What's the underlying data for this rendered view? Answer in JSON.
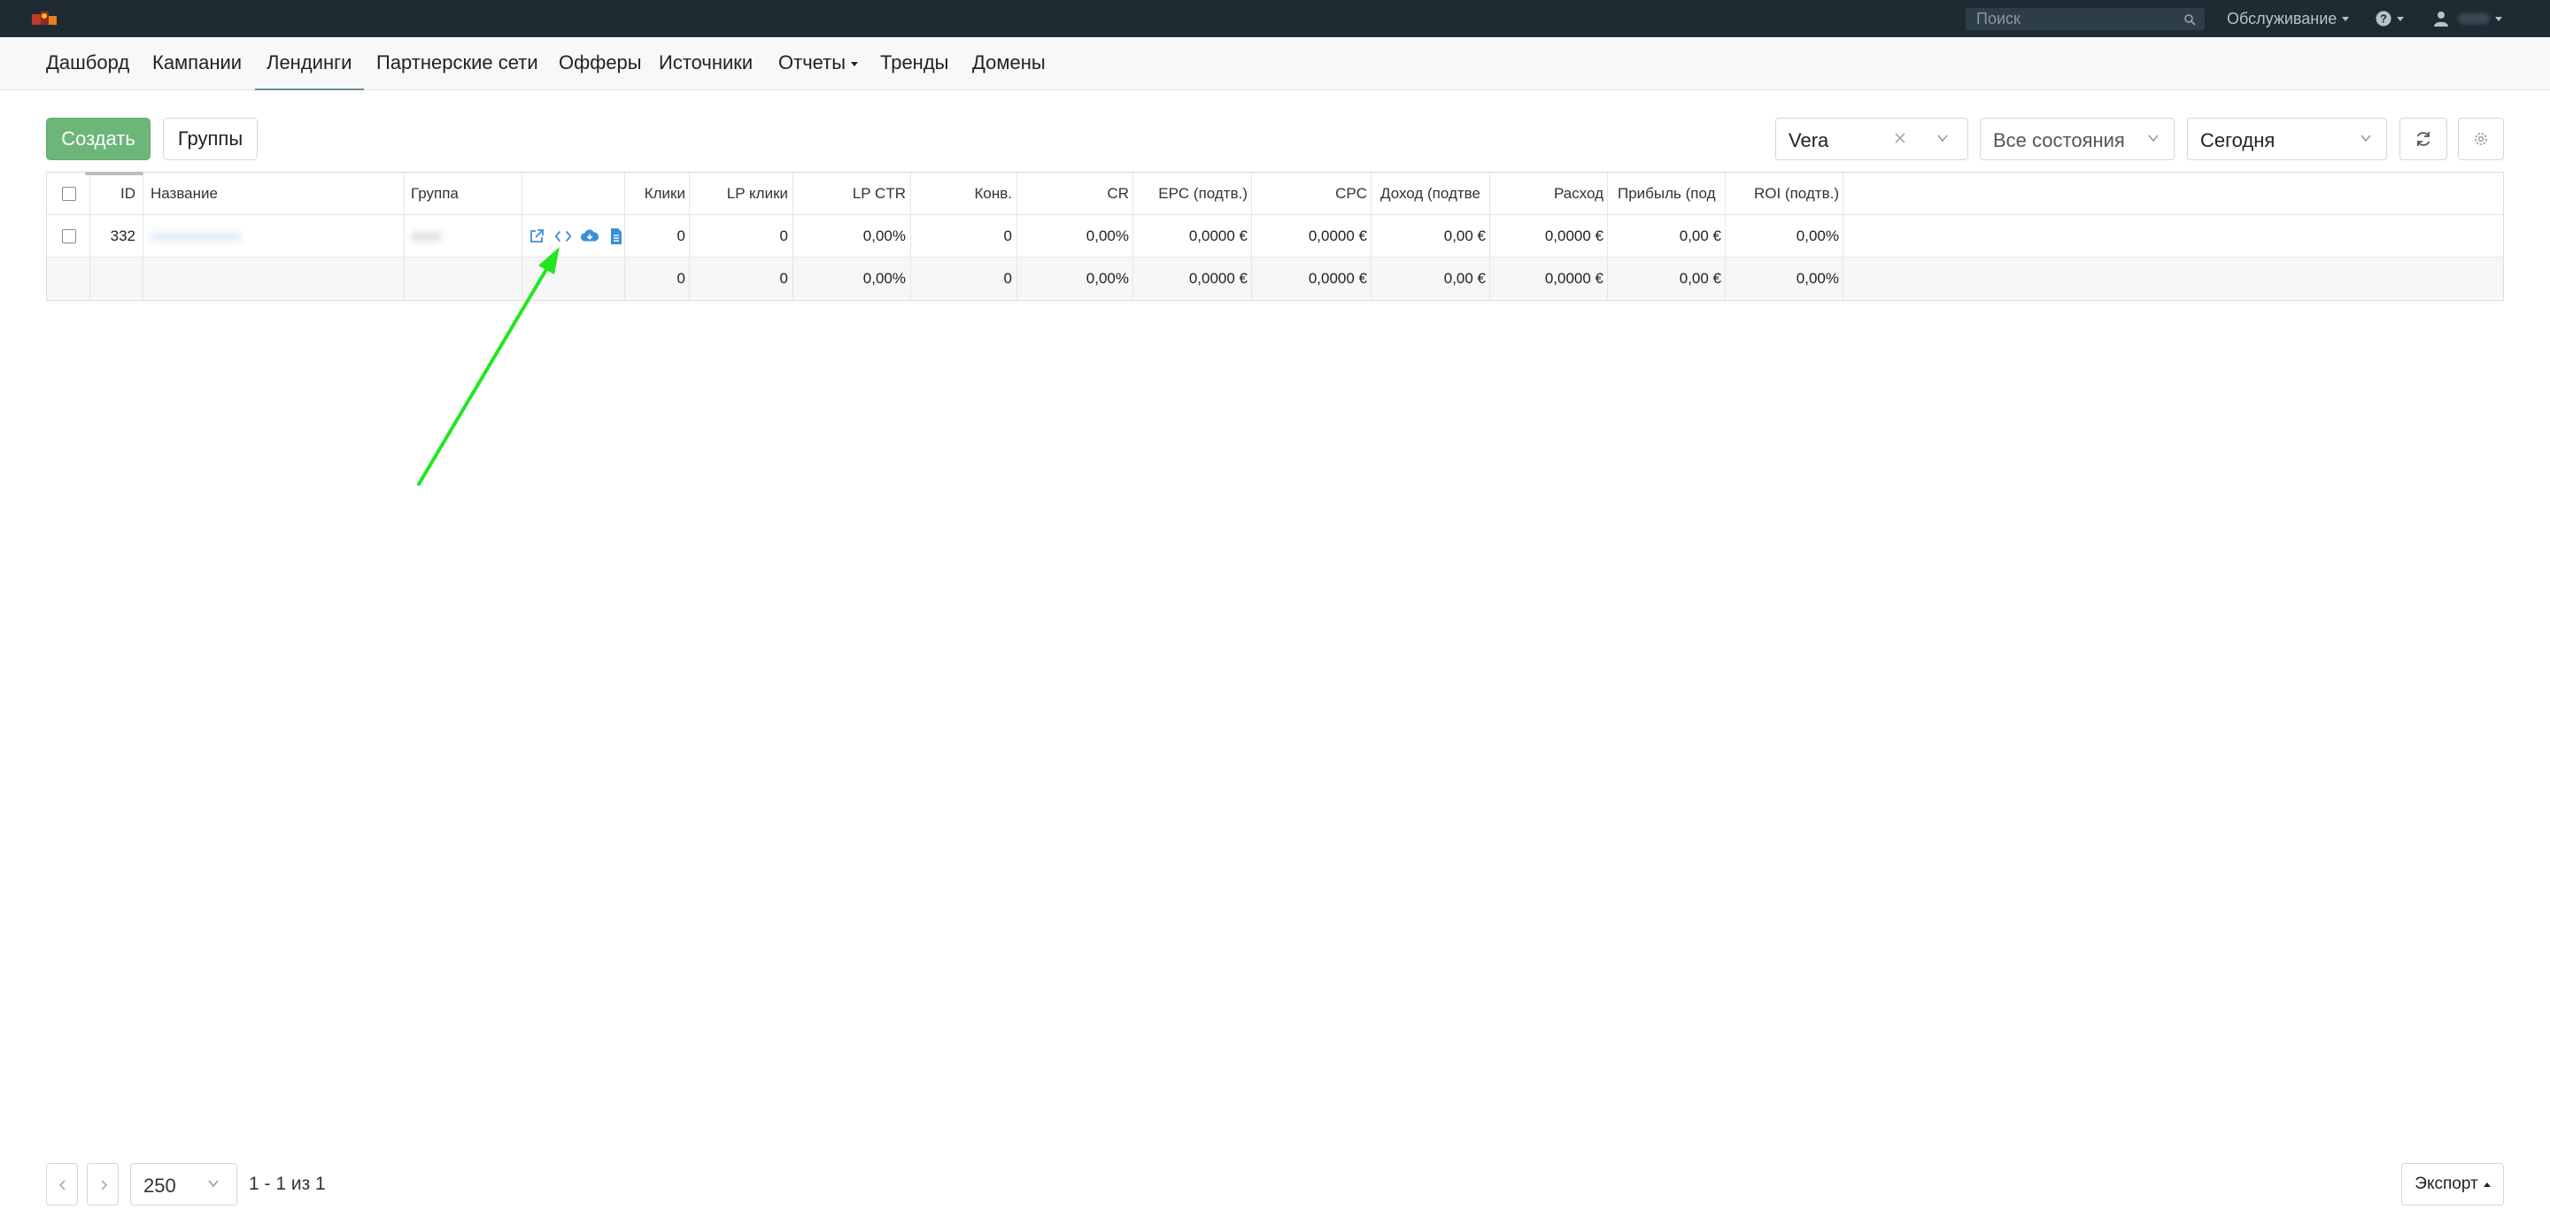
{
  "topbar": {
    "search_placeholder": "Поиск",
    "service_menu": "Обслуживание",
    "help_icon": "question-circle-icon",
    "user_icon": "user-icon"
  },
  "nav": {
    "items": [
      {
        "label": "Дашборд"
      },
      {
        "label": "Кампании"
      },
      {
        "label": "Лендинги",
        "active": true
      },
      {
        "label": "Партнерские сети"
      },
      {
        "label": "Офферы"
      },
      {
        "label": "Источники"
      },
      {
        "label": "Отчеты",
        "dropdown": true
      },
      {
        "label": "Тренды"
      },
      {
        "label": "Домены"
      }
    ]
  },
  "toolbar": {
    "create_label": "Создать",
    "groups_label": "Группы",
    "filter_user": "Vera",
    "filter_state": "Все состояния",
    "filter_period": "Сегодня"
  },
  "table": {
    "columns": {
      "id": "ID",
      "name": "Название",
      "group": "Группа",
      "clicks": "Клики",
      "lp_clicks": "LP клики",
      "lp_ctr": "LP CTR",
      "conv": "Конв.",
      "cr": "CR",
      "epc": "EPC (подтв.)",
      "cpc": "CPC",
      "revenue": "Доход (подтве",
      "cost": "Расход",
      "profit": "Прибыль (под",
      "roi": "ROI (подтв.)"
    },
    "row": {
      "id": "332",
      "name": "xxxxxxxxxxxx",
      "group": "xxxx",
      "clicks": "0",
      "lp_clicks": "0",
      "lp_ctr": "0,00%",
      "conv": "0",
      "cr": "0,00%",
      "epc": "0,0000 €",
      "cpc": "0,0000 €",
      "revenue": "0,00 €",
      "cost": "0,0000 €",
      "profit": "0,00 €",
      "roi": "0,00%"
    },
    "totals": {
      "clicks": "0",
      "lp_clicks": "0",
      "lp_ctr": "0,00%",
      "conv": "0",
      "cr": "0,00%",
      "epc": "0,0000 €",
      "cpc": "0,0000 €",
      "revenue": "0,00 €",
      "cost": "0,0000 €",
      "profit": "0,00 €",
      "roi": "0,00%"
    }
  },
  "footer": {
    "page_size": "250",
    "page_info": "1 - 1 из 1",
    "export_label": "Экспорт"
  },
  "colors": {
    "topbar": "#1e2b33",
    "create_button": "#6cb67a",
    "action_icon": "#3b8fd9",
    "annotation_arrow": "#22e622"
  }
}
